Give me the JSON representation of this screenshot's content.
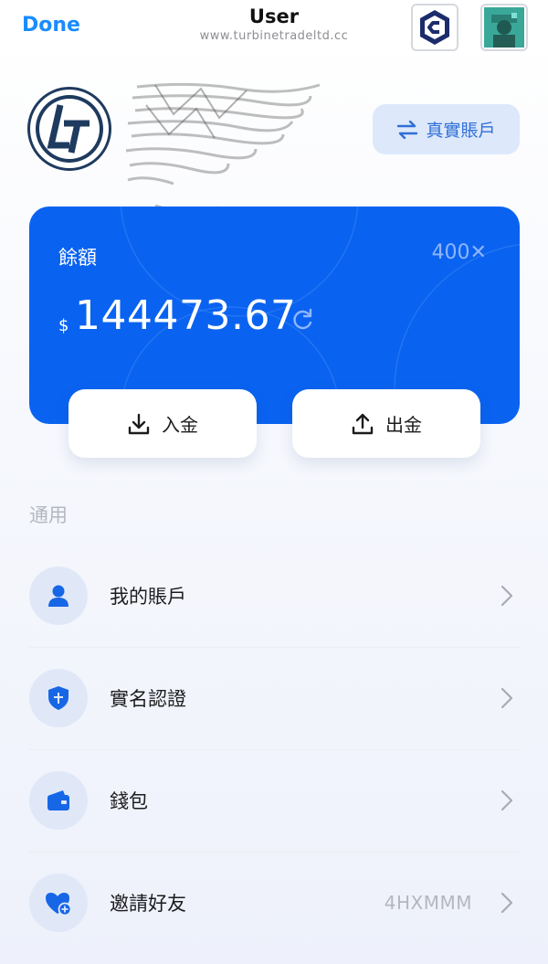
{
  "header": {
    "done_label": "Done",
    "title": "User",
    "url": "www.turbinetradeltd.cc"
  },
  "profile": {
    "account_type_label": "真實賬戶"
  },
  "balance": {
    "label": "餘額",
    "leverage": "400✕",
    "currency_symbol": "$",
    "amount": "144473.67"
  },
  "actions": {
    "deposit_label": "入金",
    "withdraw_label": "出金"
  },
  "section_title": "通用",
  "menu": [
    {
      "label": "我的賬戶",
      "icon": "person-icon"
    },
    {
      "label": "實名認證",
      "icon": "shield-icon"
    },
    {
      "label": "錢包",
      "icon": "wallet-icon"
    },
    {
      "label": "邀請好友",
      "icon": "heart-add-icon",
      "value": "4HXMMM"
    }
  ],
  "colors": {
    "accent": "#1a8cff",
    "card": "#0a63f0",
    "icon_blue": "#1766e6"
  }
}
